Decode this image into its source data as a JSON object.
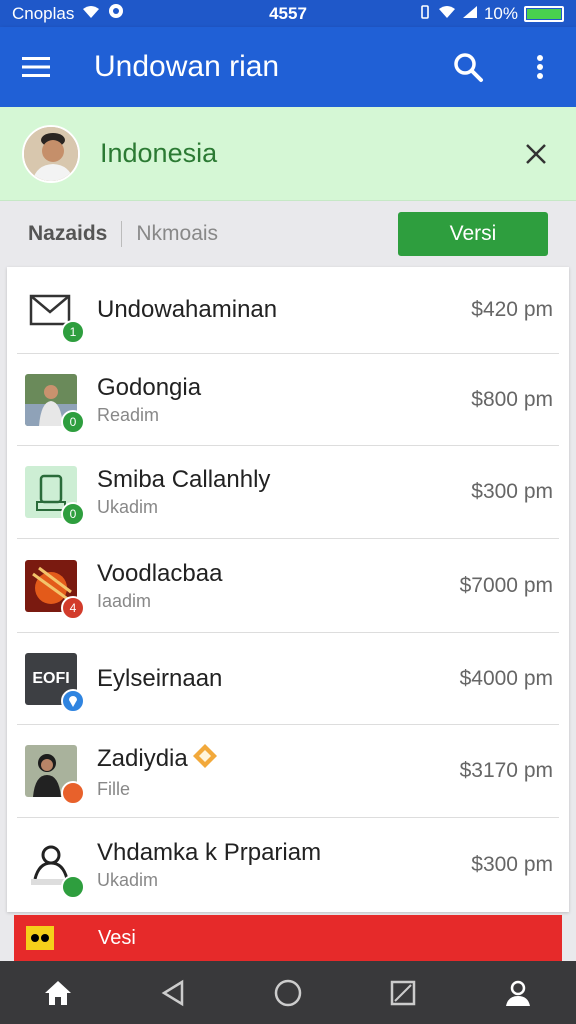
{
  "status_bar": {
    "carrier": "Cnoplas",
    "time": "4557",
    "battery": "10%",
    "battery_level": 0.1
  },
  "app_bar": {
    "title": "Undowan rian",
    "icons": [
      "menu-icon",
      "search-icon",
      "more-vert-icon"
    ]
  },
  "banner": {
    "label": "Indonesia"
  },
  "filters": {
    "primary": "Nazaids",
    "secondary": "Nkmoais",
    "button": "Versi"
  },
  "items": [
    {
      "name": "Undowahaminan",
      "subtitle": "",
      "price": "$420 pm",
      "badge": "1",
      "badge_color": "#2e9e3e"
    },
    {
      "name": "Godongia",
      "subtitle": "Readim",
      "price": "$800 pm",
      "badge": "0",
      "badge_color": "#2e9e3e"
    },
    {
      "name": "Smiba Callanhly",
      "subtitle": "Ukadim",
      "price": "$300 pm",
      "badge": "0",
      "badge_color": "#2e9e3e"
    },
    {
      "name": "Voodlacbaa",
      "subtitle": "Iaadim",
      "price": "$7000 pm",
      "badge": "4",
      "badge_color": "#d23b2b"
    },
    {
      "name": "Eylseirnaan",
      "subtitle": "",
      "price": "$4000 pm",
      "badge": "",
      "badge_color": "#2f84e0"
    },
    {
      "name": "Zadiydia",
      "subtitle": "Fille",
      "price": "$3170 pm",
      "badge": "",
      "badge_color": "#e8612b"
    },
    {
      "name": "Vhdamka k Prpariam",
      "subtitle": "Ukadim",
      "price": "$300 pm",
      "badge": "",
      "badge_color": "#2e9e3e"
    }
  ],
  "thumb_labels": {
    "eyl": "EOFI"
  },
  "red_banner": {
    "label": "Vesi"
  },
  "colors": {
    "app_bar": "#2060d6",
    "banner_bg": "#d5f7d5",
    "accent_green": "#2e9e3e",
    "red_bar": "#e62a2a"
  }
}
